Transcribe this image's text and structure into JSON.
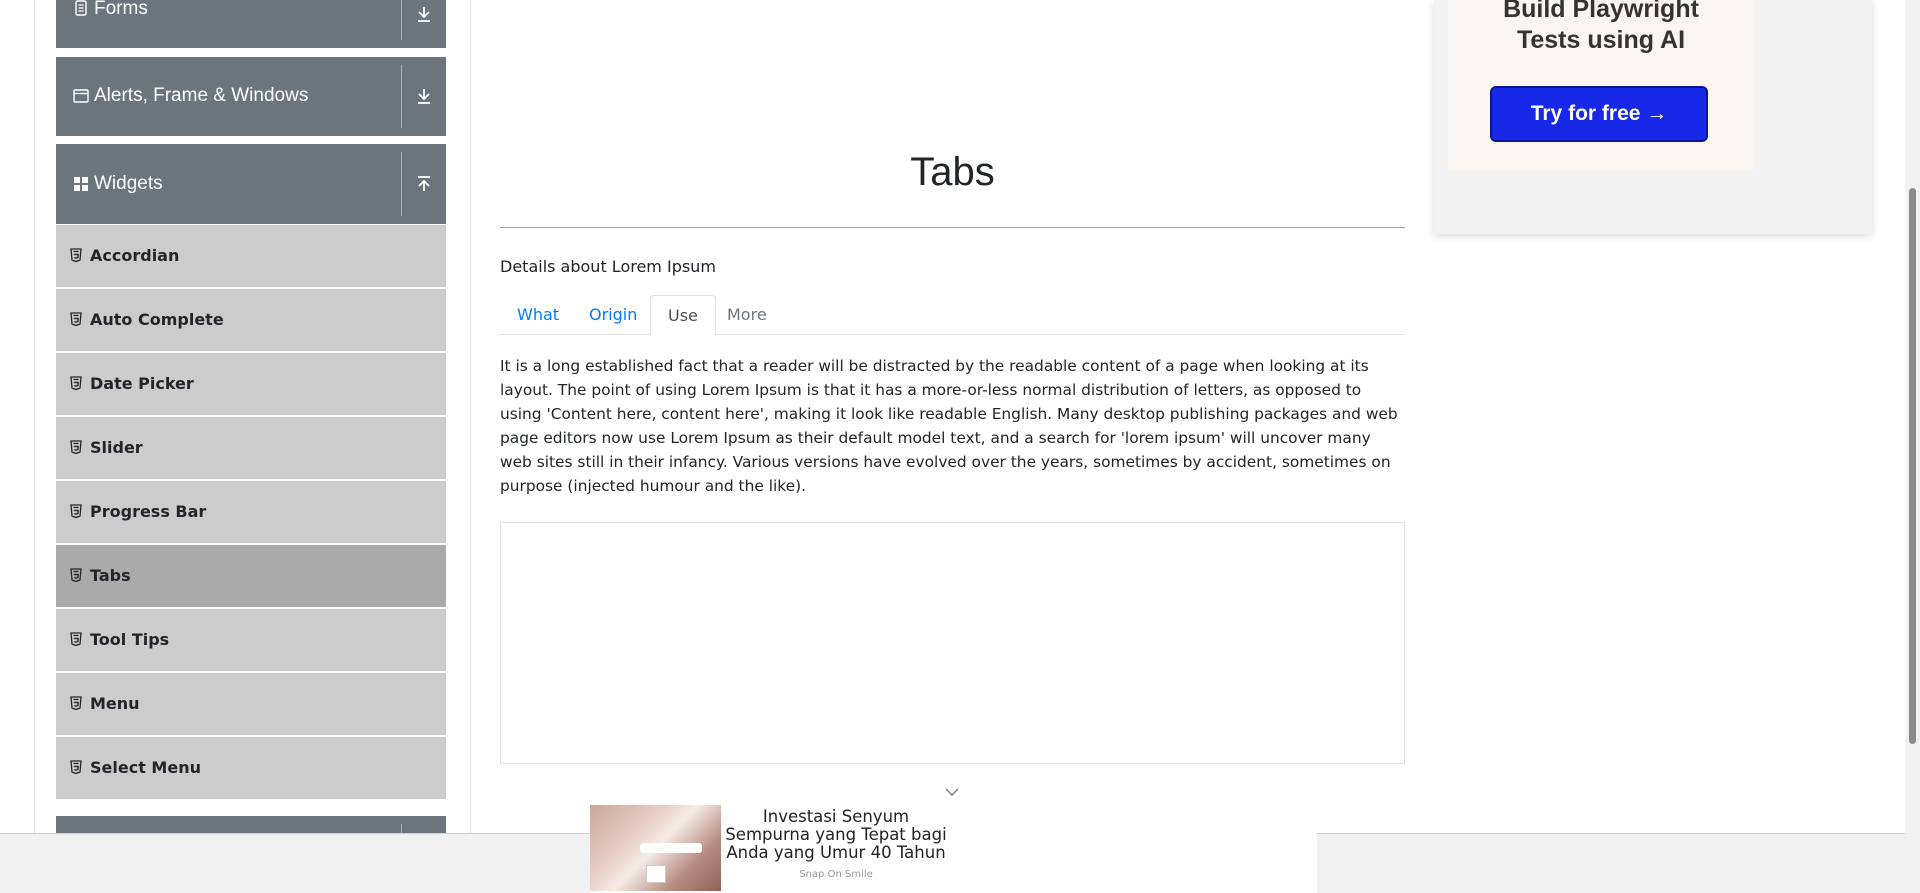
{
  "sidebar": {
    "groups": [
      {
        "label": "Forms",
        "icon": "form-icon",
        "toggle": "expand-icon"
      },
      {
        "label": "Alerts, Frame & Windows",
        "icon": "window-icon",
        "toggle": "expand-icon"
      },
      {
        "label": "Widgets",
        "icon": "widgets-icon",
        "toggle": "collapse-icon"
      }
    ],
    "items": [
      {
        "label": "Accordian"
      },
      {
        "label": "Auto Complete"
      },
      {
        "label": "Date Picker"
      },
      {
        "label": "Slider"
      },
      {
        "label": "Progress Bar"
      },
      {
        "label": "Tabs",
        "active": true
      },
      {
        "label": "Tool Tips"
      },
      {
        "label": "Menu"
      },
      {
        "label": "Select Menu"
      }
    ]
  },
  "main": {
    "title": "Tabs",
    "details": "Details about Lorem Ipsum",
    "tabs": [
      {
        "label": "What",
        "state": "normal"
      },
      {
        "label": "Origin",
        "state": "normal"
      },
      {
        "label": "Use",
        "state": "active"
      },
      {
        "label": "More",
        "state": "disabled"
      }
    ],
    "content": "It is a long established fact that a reader will be distracted by the readable content of a page when looking at its layout. The point of using Lorem Ipsum is that it has a more-or-less normal distribution of letters, as opposed to using 'Content here, content here', making it look like readable English. Many desktop publishing packages and web page editors now use Lorem Ipsum as their default model text, and a search for 'lorem ipsum' will uncover many web sites still in their infancy. Various versions have evolved over the years, sometimes by accident, sometimes on purpose (injected humour and the like)."
  },
  "promo": {
    "title_line1": "Build Playwright",
    "title_line2": "Tests using AI",
    "button": "Try for free →"
  },
  "bottom_ad": {
    "headline": "Investasi Senyum Sempurna yang Tepat bagi Anda yang Umur 40 Tahun",
    "brand": "Snap On Smile"
  },
  "colors": {
    "group_header": "#6c757d",
    "menu_item": "#cccccc",
    "menu_item_active": "#aaaaaa",
    "link": "#007bff",
    "promo_button": "#1728e8"
  }
}
